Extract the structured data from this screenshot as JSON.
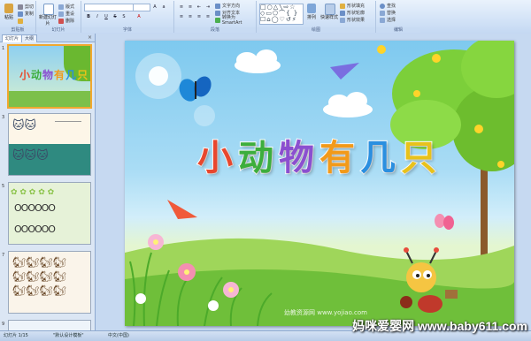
{
  "ribbon": {
    "groups": {
      "clipboard": "剪贴板",
      "slides": "幻灯片",
      "font": "字体",
      "paragraph": "段落",
      "drawing": "绘图",
      "editing": "编辑"
    },
    "paste_label": "粘贴",
    "cut_label": "剪切",
    "copy_label": "复制",
    "new_slide_label": "新建幻灯片",
    "layout_label": "版式",
    "reset_label": "重设",
    "delete_label": "删除",
    "text_direction_label": "文字方向",
    "align_text_label": "对齐文本",
    "convert_smartart_label": "转换为 SmartArt",
    "arrange_label": "排列",
    "quick_styles_label": "快速样式",
    "shape_fill_label": "形状填充",
    "shape_outline_label": "形状轮廓",
    "shape_effects_label": "形状效果",
    "find_label": "查找",
    "replace_label": "替换",
    "select_label": "选择",
    "font_size_value": "",
    "font_name_value": ""
  },
  "pane": {
    "tab_slides": "幻灯片",
    "tab_outline": "大纲",
    "slide_numbers": [
      "1",
      "3",
      "5",
      "7",
      "9"
    ],
    "close_glyph": "×"
  },
  "slide": {
    "title_chars": [
      "小",
      "动",
      "物",
      "有",
      "几",
      "只"
    ],
    "title_colors": [
      "#e8472e",
      "#3cae3c",
      "#8b4fd0",
      "#f29a1a",
      "#2a8fe0",
      "#e8c21a"
    ],
    "watermark": "幼教资源网 www.yojiao.com"
  },
  "status": {
    "slide_info": "幻灯片 1/15",
    "theme": "\"默认设计模板\"",
    "language": "中文(中国)"
  },
  "site_watermark": "妈咪爱婴网 www.baby611.com"
}
